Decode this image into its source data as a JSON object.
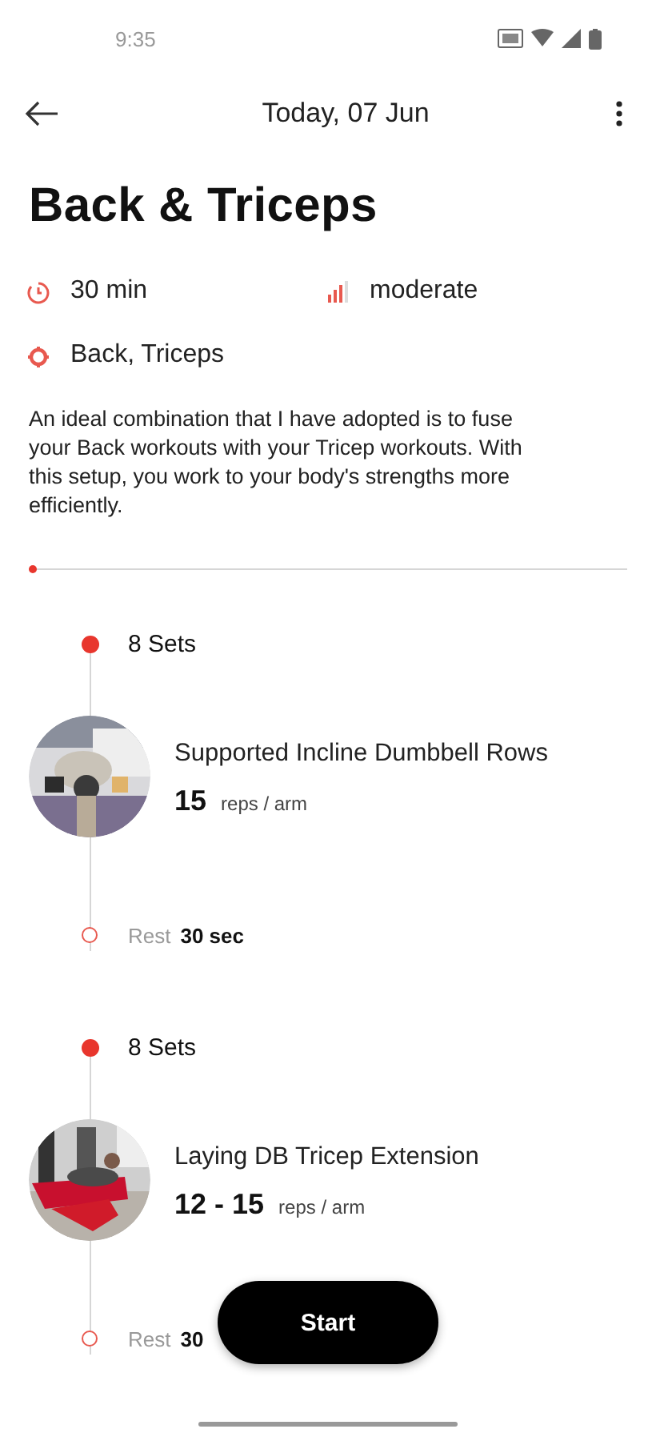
{
  "status_bar": {
    "time": "9:35"
  },
  "app_bar": {
    "title": "Today, 07 Jun"
  },
  "workout": {
    "title": "Back & Triceps",
    "meta": [
      {
        "kind": "duration",
        "text": "30 min"
      },
      {
        "kind": "intensity",
        "text": "moderate"
      },
      {
        "kind": "muscles",
        "text": "Back, Triceps"
      }
    ],
    "description": "An ideal combination that I have adopted is to fuse your Back workouts with your Tricep workouts. With this setup, you work to your body's strengths more efficiently.",
    "progress": {
      "level": 0
    }
  },
  "exercises": [
    {
      "sets": "8 Sets",
      "name": "Supported Incline Dumbbell Rows",
      "reps": "15",
      "unit": "reps / arm",
      "rest_label": "Rest",
      "rest_value": "30 sec"
    },
    {
      "sets": "8 Sets",
      "name": "Laying DB Tricep Extension",
      "reps": "12 - 15",
      "unit": "reps / arm",
      "rest_label": "Rest",
      "rest_value": "30"
    }
  ],
  "start_button": {
    "label": "Start"
  }
}
